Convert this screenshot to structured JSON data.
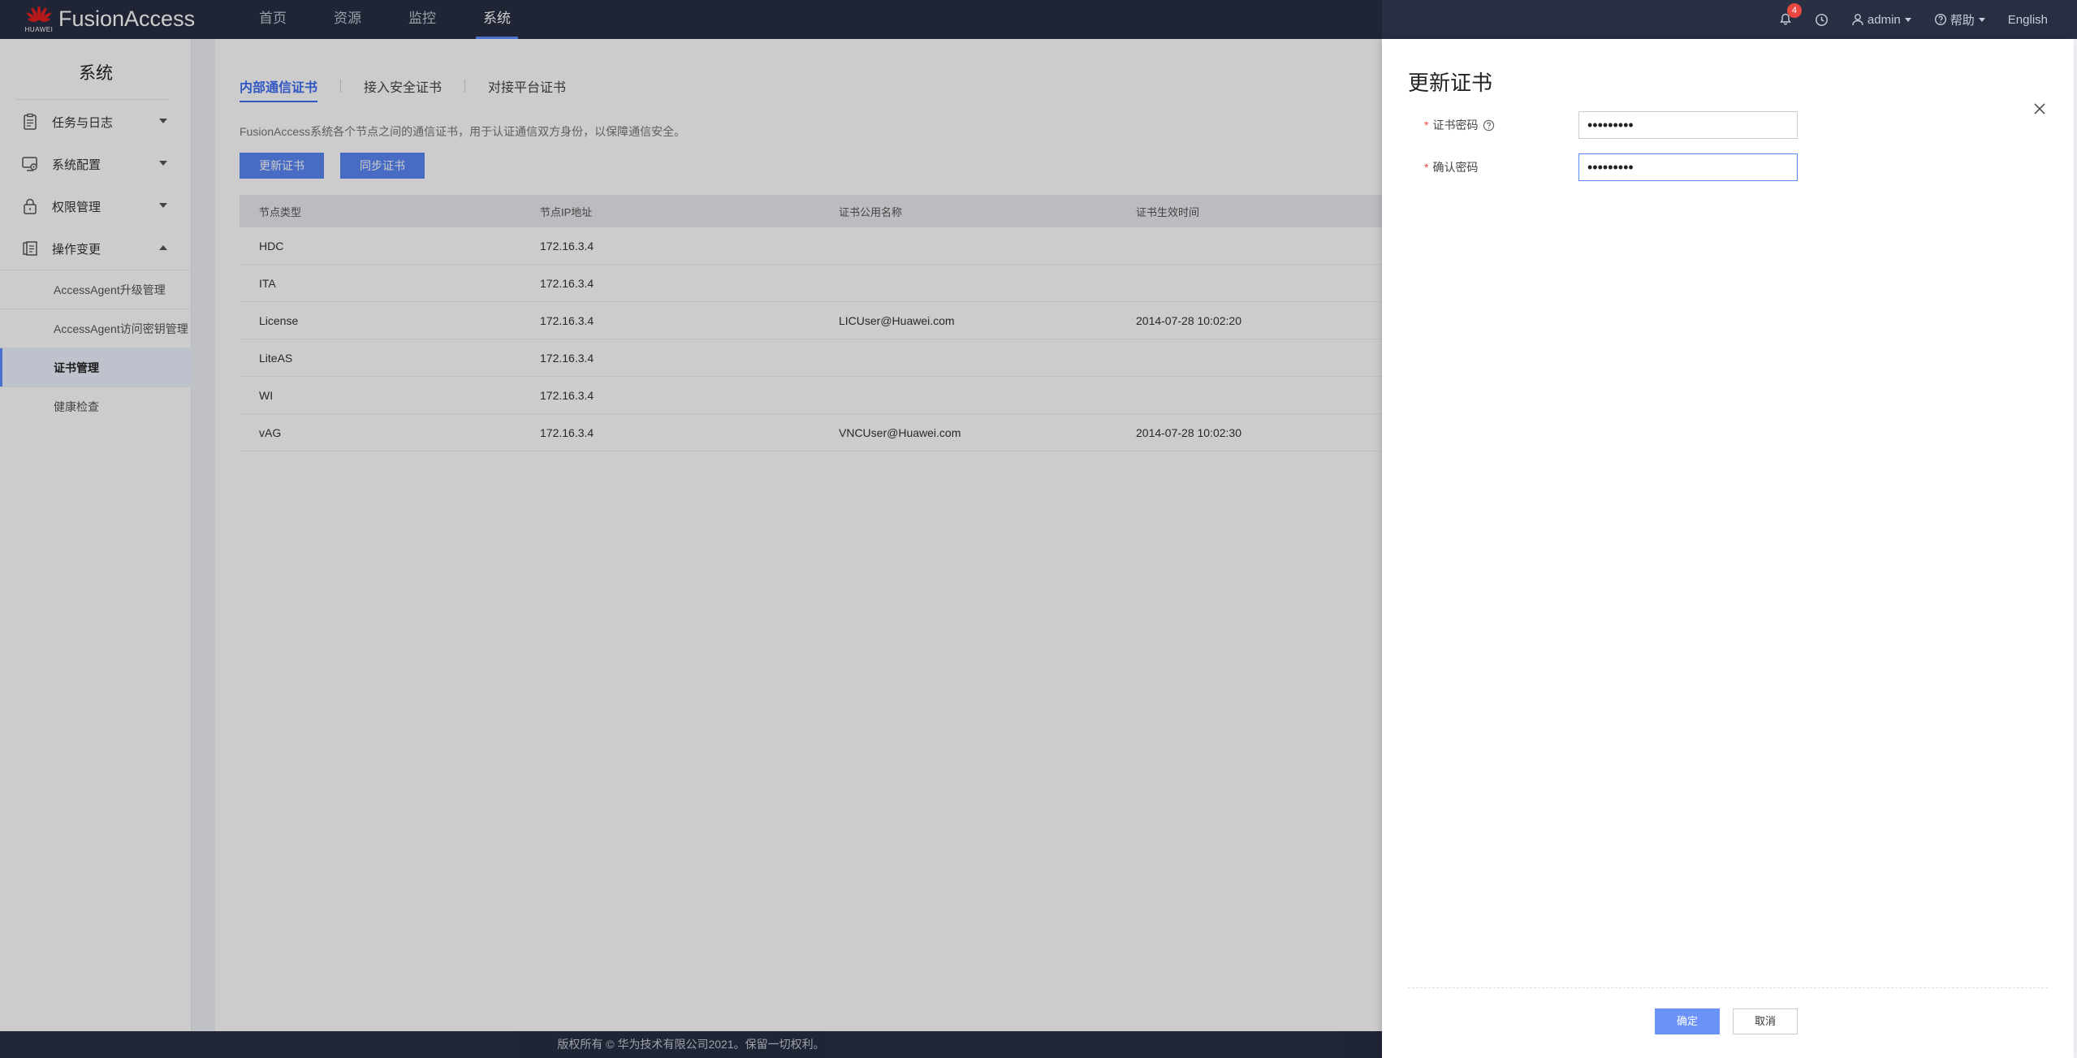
{
  "header": {
    "brand": "HUAWEI",
    "product": "FusionAccess",
    "nav": [
      "首页",
      "资源",
      "监控",
      "系统"
    ],
    "active_nav": "系统",
    "notification_count": "4",
    "user": "admin",
    "help": "帮助",
    "language": "English"
  },
  "sidebar": {
    "title": "系统",
    "groups": [
      {
        "label": "任务与日志",
        "icon": "clipboard-icon",
        "expanded": false
      },
      {
        "label": "系统配置",
        "icon": "system-config-icon",
        "expanded": false
      },
      {
        "label": "权限管理",
        "icon": "lock-icon",
        "expanded": false
      },
      {
        "label": "操作变更",
        "icon": "change-list-icon",
        "expanded": true
      }
    ],
    "subitems": [
      "AccessAgent升级管理",
      "AccessAgent访问密钥管理",
      "证书管理",
      "健康检查"
    ],
    "active_subitem": "证书管理"
  },
  "main": {
    "tabs": [
      "内部通信证书",
      "接入安全证书",
      "对接平台证书"
    ],
    "active_tab": "内部通信证书",
    "description": "FusionAccess系统各个节点之间的通信证书，用于认证通信双方身份，以保障通信安全。",
    "buttons": {
      "update": "更新证书",
      "sync": "同步证书"
    },
    "table": {
      "columns": [
        "节点类型",
        "节点IP地址",
        "证书公用名称",
        "证书生效时间"
      ],
      "rows": [
        [
          "HDC",
          "172.16.3.4",
          "",
          ""
        ],
        [
          "ITA",
          "172.16.3.4",
          "",
          ""
        ],
        [
          "License",
          "172.16.3.4",
          "LICUser@Huawei.com",
          "2014-07-28 10:02:20"
        ],
        [
          "LiteAS",
          "172.16.3.4",
          "",
          ""
        ],
        [
          "WI",
          "172.16.3.4",
          "",
          ""
        ],
        [
          "vAG",
          "172.16.3.4",
          "VNCUser@Huawei.com",
          "2014-07-28 10:02:30"
        ]
      ]
    }
  },
  "drawer": {
    "title": "更新证书",
    "fields": {
      "cert_password": {
        "label": "证书密码",
        "value": "•••••••••"
      },
      "confirm_password": {
        "label": "确认密码",
        "value": "•••••••••"
      }
    },
    "ok": "确定",
    "cancel": "取消"
  },
  "footer": {
    "text": "版权所有 © 华为技术有限公司2021。保留一切权利。"
  },
  "colors": {
    "topbar": "#282f43",
    "accent": "#5a8cff",
    "button": "#5b86f5",
    "badge": "#e8483f"
  }
}
